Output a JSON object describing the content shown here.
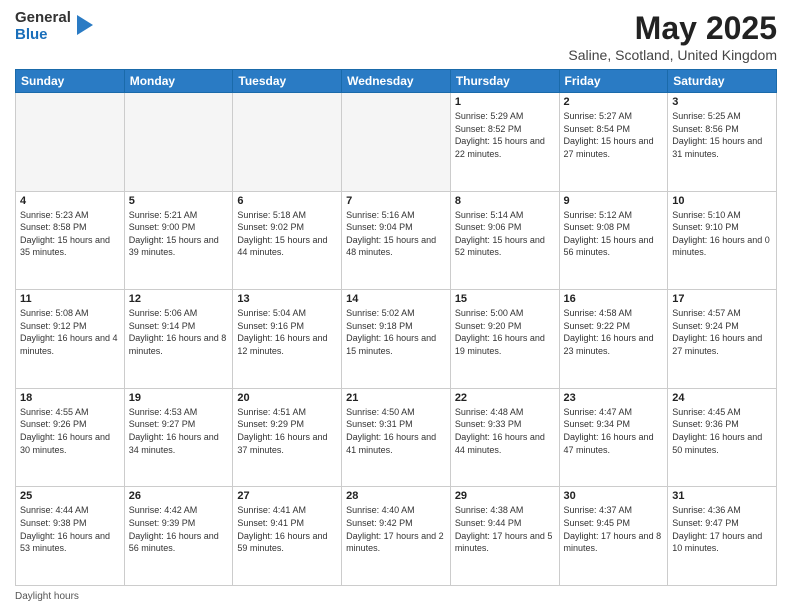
{
  "logo": {
    "general": "General",
    "blue": "Blue"
  },
  "header": {
    "title": "May 2025",
    "subtitle": "Saline, Scotland, United Kingdom"
  },
  "days_of_week": [
    "Sunday",
    "Monday",
    "Tuesday",
    "Wednesday",
    "Thursday",
    "Friday",
    "Saturday"
  ],
  "footer": {
    "label": "Daylight hours"
  },
  "weeks": [
    [
      {
        "day": "",
        "sunrise": "",
        "sunset": "",
        "daylight": ""
      },
      {
        "day": "",
        "sunrise": "",
        "sunset": "",
        "daylight": ""
      },
      {
        "day": "",
        "sunrise": "",
        "sunset": "",
        "daylight": ""
      },
      {
        "day": "",
        "sunrise": "",
        "sunset": "",
        "daylight": ""
      },
      {
        "day": "1",
        "sunrise": "Sunrise: 5:29 AM",
        "sunset": "Sunset: 8:52 PM",
        "daylight": "Daylight: 15 hours and 22 minutes."
      },
      {
        "day": "2",
        "sunrise": "Sunrise: 5:27 AM",
        "sunset": "Sunset: 8:54 PM",
        "daylight": "Daylight: 15 hours and 27 minutes."
      },
      {
        "day": "3",
        "sunrise": "Sunrise: 5:25 AM",
        "sunset": "Sunset: 8:56 PM",
        "daylight": "Daylight: 15 hours and 31 minutes."
      }
    ],
    [
      {
        "day": "4",
        "sunrise": "Sunrise: 5:23 AM",
        "sunset": "Sunset: 8:58 PM",
        "daylight": "Daylight: 15 hours and 35 minutes."
      },
      {
        "day": "5",
        "sunrise": "Sunrise: 5:21 AM",
        "sunset": "Sunset: 9:00 PM",
        "daylight": "Daylight: 15 hours and 39 minutes."
      },
      {
        "day": "6",
        "sunrise": "Sunrise: 5:18 AM",
        "sunset": "Sunset: 9:02 PM",
        "daylight": "Daylight: 15 hours and 44 minutes."
      },
      {
        "day": "7",
        "sunrise": "Sunrise: 5:16 AM",
        "sunset": "Sunset: 9:04 PM",
        "daylight": "Daylight: 15 hours and 48 minutes."
      },
      {
        "day": "8",
        "sunrise": "Sunrise: 5:14 AM",
        "sunset": "Sunset: 9:06 PM",
        "daylight": "Daylight: 15 hours and 52 minutes."
      },
      {
        "day": "9",
        "sunrise": "Sunrise: 5:12 AM",
        "sunset": "Sunset: 9:08 PM",
        "daylight": "Daylight: 15 hours and 56 minutes."
      },
      {
        "day": "10",
        "sunrise": "Sunrise: 5:10 AM",
        "sunset": "Sunset: 9:10 PM",
        "daylight": "Daylight: 16 hours and 0 minutes."
      }
    ],
    [
      {
        "day": "11",
        "sunrise": "Sunrise: 5:08 AM",
        "sunset": "Sunset: 9:12 PM",
        "daylight": "Daylight: 16 hours and 4 minutes."
      },
      {
        "day": "12",
        "sunrise": "Sunrise: 5:06 AM",
        "sunset": "Sunset: 9:14 PM",
        "daylight": "Daylight: 16 hours and 8 minutes."
      },
      {
        "day": "13",
        "sunrise": "Sunrise: 5:04 AM",
        "sunset": "Sunset: 9:16 PM",
        "daylight": "Daylight: 16 hours and 12 minutes."
      },
      {
        "day": "14",
        "sunrise": "Sunrise: 5:02 AM",
        "sunset": "Sunset: 9:18 PM",
        "daylight": "Daylight: 16 hours and 15 minutes."
      },
      {
        "day": "15",
        "sunrise": "Sunrise: 5:00 AM",
        "sunset": "Sunset: 9:20 PM",
        "daylight": "Daylight: 16 hours and 19 minutes."
      },
      {
        "day": "16",
        "sunrise": "Sunrise: 4:58 AM",
        "sunset": "Sunset: 9:22 PM",
        "daylight": "Daylight: 16 hours and 23 minutes."
      },
      {
        "day": "17",
        "sunrise": "Sunrise: 4:57 AM",
        "sunset": "Sunset: 9:24 PM",
        "daylight": "Daylight: 16 hours and 27 minutes."
      }
    ],
    [
      {
        "day": "18",
        "sunrise": "Sunrise: 4:55 AM",
        "sunset": "Sunset: 9:26 PM",
        "daylight": "Daylight: 16 hours and 30 minutes."
      },
      {
        "day": "19",
        "sunrise": "Sunrise: 4:53 AM",
        "sunset": "Sunset: 9:27 PM",
        "daylight": "Daylight: 16 hours and 34 minutes."
      },
      {
        "day": "20",
        "sunrise": "Sunrise: 4:51 AM",
        "sunset": "Sunset: 9:29 PM",
        "daylight": "Daylight: 16 hours and 37 minutes."
      },
      {
        "day": "21",
        "sunrise": "Sunrise: 4:50 AM",
        "sunset": "Sunset: 9:31 PM",
        "daylight": "Daylight: 16 hours and 41 minutes."
      },
      {
        "day": "22",
        "sunrise": "Sunrise: 4:48 AM",
        "sunset": "Sunset: 9:33 PM",
        "daylight": "Daylight: 16 hours and 44 minutes."
      },
      {
        "day": "23",
        "sunrise": "Sunrise: 4:47 AM",
        "sunset": "Sunset: 9:34 PM",
        "daylight": "Daylight: 16 hours and 47 minutes."
      },
      {
        "day": "24",
        "sunrise": "Sunrise: 4:45 AM",
        "sunset": "Sunset: 9:36 PM",
        "daylight": "Daylight: 16 hours and 50 minutes."
      }
    ],
    [
      {
        "day": "25",
        "sunrise": "Sunrise: 4:44 AM",
        "sunset": "Sunset: 9:38 PM",
        "daylight": "Daylight: 16 hours and 53 minutes."
      },
      {
        "day": "26",
        "sunrise": "Sunrise: 4:42 AM",
        "sunset": "Sunset: 9:39 PM",
        "daylight": "Daylight: 16 hours and 56 minutes."
      },
      {
        "day": "27",
        "sunrise": "Sunrise: 4:41 AM",
        "sunset": "Sunset: 9:41 PM",
        "daylight": "Daylight: 16 hours and 59 minutes."
      },
      {
        "day": "28",
        "sunrise": "Sunrise: 4:40 AM",
        "sunset": "Sunset: 9:42 PM",
        "daylight": "Daylight: 17 hours and 2 minutes."
      },
      {
        "day": "29",
        "sunrise": "Sunrise: 4:38 AM",
        "sunset": "Sunset: 9:44 PM",
        "daylight": "Daylight: 17 hours and 5 minutes."
      },
      {
        "day": "30",
        "sunrise": "Sunrise: 4:37 AM",
        "sunset": "Sunset: 9:45 PM",
        "daylight": "Daylight: 17 hours and 8 minutes."
      },
      {
        "day": "31",
        "sunrise": "Sunrise: 4:36 AM",
        "sunset": "Sunset: 9:47 PM",
        "daylight": "Daylight: 17 hours and 10 minutes."
      }
    ]
  ]
}
